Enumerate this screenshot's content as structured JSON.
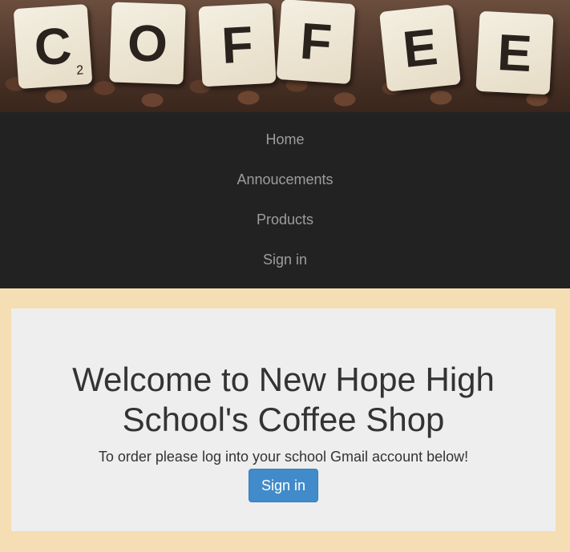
{
  "banner": {
    "tiles": [
      {
        "letter": "C",
        "sub": "2"
      },
      {
        "letter": "O",
        "sub": ""
      },
      {
        "letter": "F",
        "sub": ""
      },
      {
        "letter": "F",
        "sub": ""
      },
      {
        "letter": "E",
        "sub": ""
      },
      {
        "letter": "E",
        "sub": ""
      }
    ]
  },
  "nav": {
    "items": [
      {
        "label": "Home"
      },
      {
        "label": "Annoucements"
      },
      {
        "label": "Products"
      },
      {
        "label": "Sign in"
      }
    ]
  },
  "main": {
    "heading": "Welcome to New Hope High School's Coffee Shop",
    "subtext": "To order please log into your school Gmail account below!",
    "signin_label": "Sign in"
  },
  "colors": {
    "page_bg": "#f5deb3",
    "nav_bg": "#222222",
    "nav_text": "#9d9d9d",
    "panel_bg": "#eeeeee",
    "button_bg": "#428bca"
  }
}
